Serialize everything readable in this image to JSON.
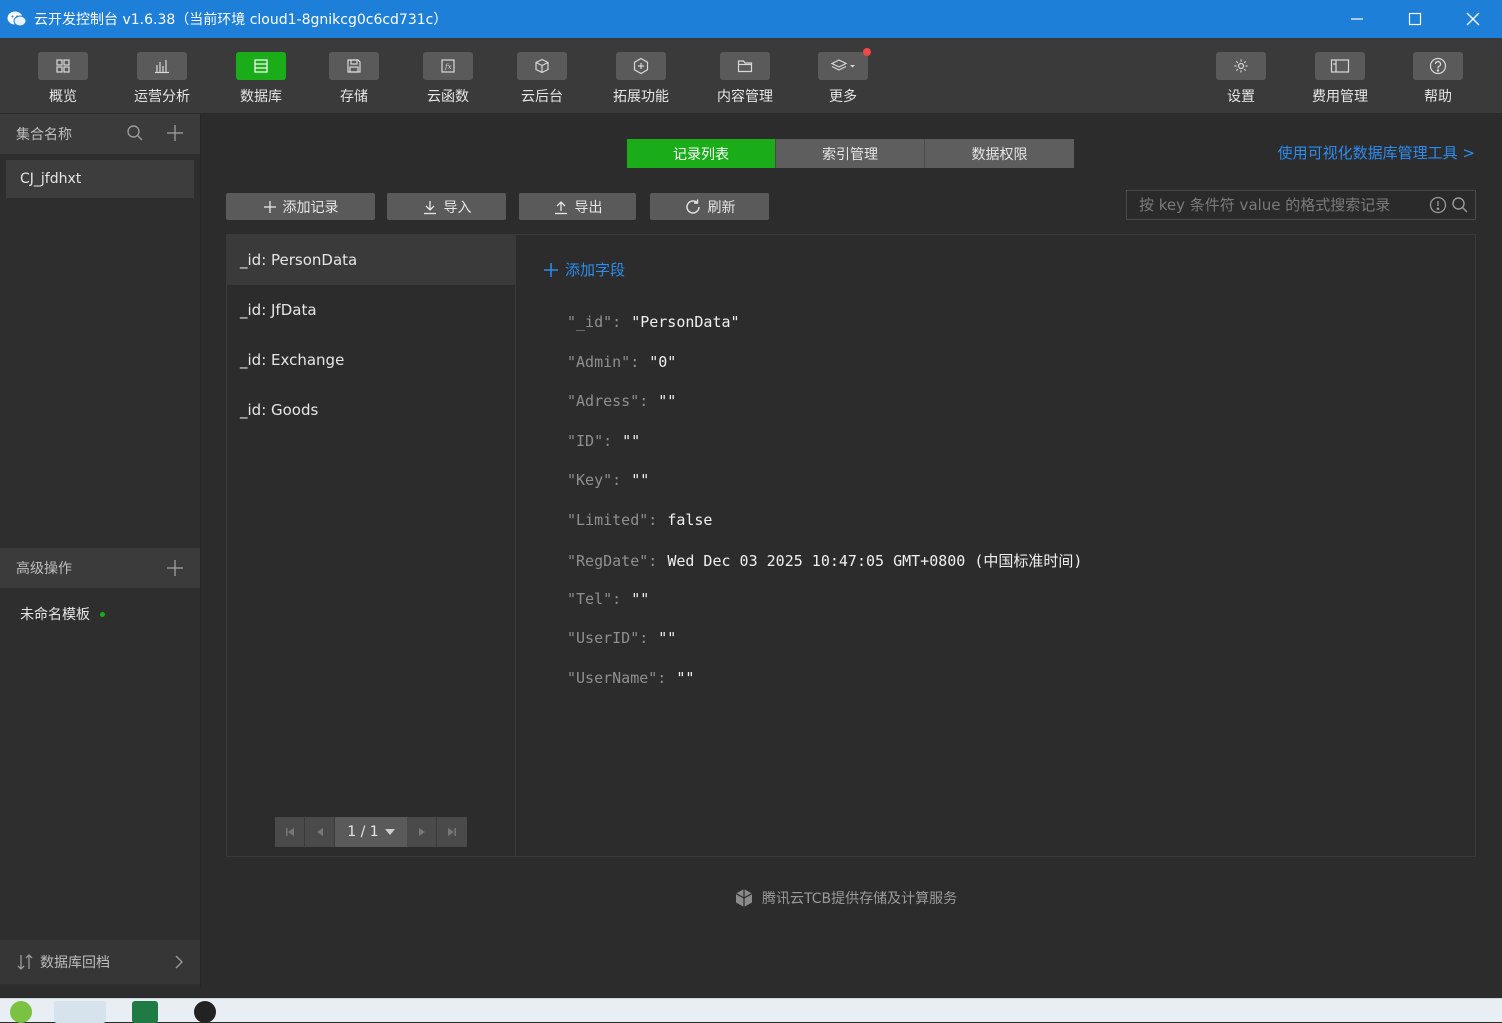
{
  "window": {
    "title": "云开发控制台 v1.6.38（当前环境 cloud1-8gnikcg0c6cd731c）"
  },
  "toolbar": {
    "items": [
      {
        "label": "概览",
        "icon": "grid-icon"
      },
      {
        "label": "运营分析",
        "icon": "bar-chart-icon"
      },
      {
        "label": "数据库",
        "icon": "database-icon",
        "active": true
      },
      {
        "label": "存储",
        "icon": "save-icon"
      },
      {
        "label": "云函数",
        "icon": "function-icon"
      },
      {
        "label": "云后台",
        "icon": "cube-icon"
      },
      {
        "label": "拓展功能",
        "icon": "extension-icon"
      },
      {
        "label": "内容管理",
        "icon": "folder-icon"
      },
      {
        "label": "更多",
        "icon": "layers-icon"
      }
    ],
    "right_items": [
      {
        "label": "设置",
        "icon": "gear-icon"
      },
      {
        "label": "费用管理",
        "icon": "billing-icon"
      },
      {
        "label": "帮助",
        "icon": "help-icon"
      }
    ]
  },
  "sidebar": {
    "collections_header": "集合名称",
    "collections": [
      "CJ_jfdhxt"
    ],
    "advanced_header": "高级操作",
    "templates": [
      "未命名模板"
    ],
    "bottom_label": "数据库回档"
  },
  "main": {
    "tabs": [
      "记录列表",
      "索引管理",
      "数据权限"
    ],
    "visual_tool_link": "使用可视化数据库管理工具 >",
    "actions": {
      "add": "添加记录",
      "import": "导入",
      "export": "导出",
      "refresh": "刷新"
    },
    "search_placeholder": "按 key 条件符 value 的格式搜索记录",
    "records": [
      "_id: PersonData",
      "_id: JfData",
      "_id: Exchange",
      "_id: Goods"
    ],
    "pager": "1 / 1",
    "add_field": "添加字段",
    "fields": [
      {
        "k": "\"_id\":",
        "v": "\"PersonData\""
      },
      {
        "k": "\"Admin\":",
        "v": "\"0\""
      },
      {
        "k": "\"Adress\":",
        "v": "\"\""
      },
      {
        "k": "\"ID\":",
        "v": "\"\""
      },
      {
        "k": "\"Key\":",
        "v": "\"\""
      },
      {
        "k": "\"Limited\":",
        "v": "false"
      },
      {
        "k": "\"RegDate\":",
        "v": "Wed Dec 03 2025 10:47:05 GMT+0800 (中国标准时间)"
      },
      {
        "k": "\"Tel\":",
        "v": "\"\""
      },
      {
        "k": "\"UserID\":",
        "v": "\"\""
      },
      {
        "k": "\"UserName\":",
        "v": "\"\""
      }
    ],
    "footer": "腾讯云TCB提供存储及计算服务"
  },
  "colors": {
    "accent_green": "#1aad19",
    "link_blue": "#2d8cf0",
    "titlebar": "#1e7fd9"
  }
}
